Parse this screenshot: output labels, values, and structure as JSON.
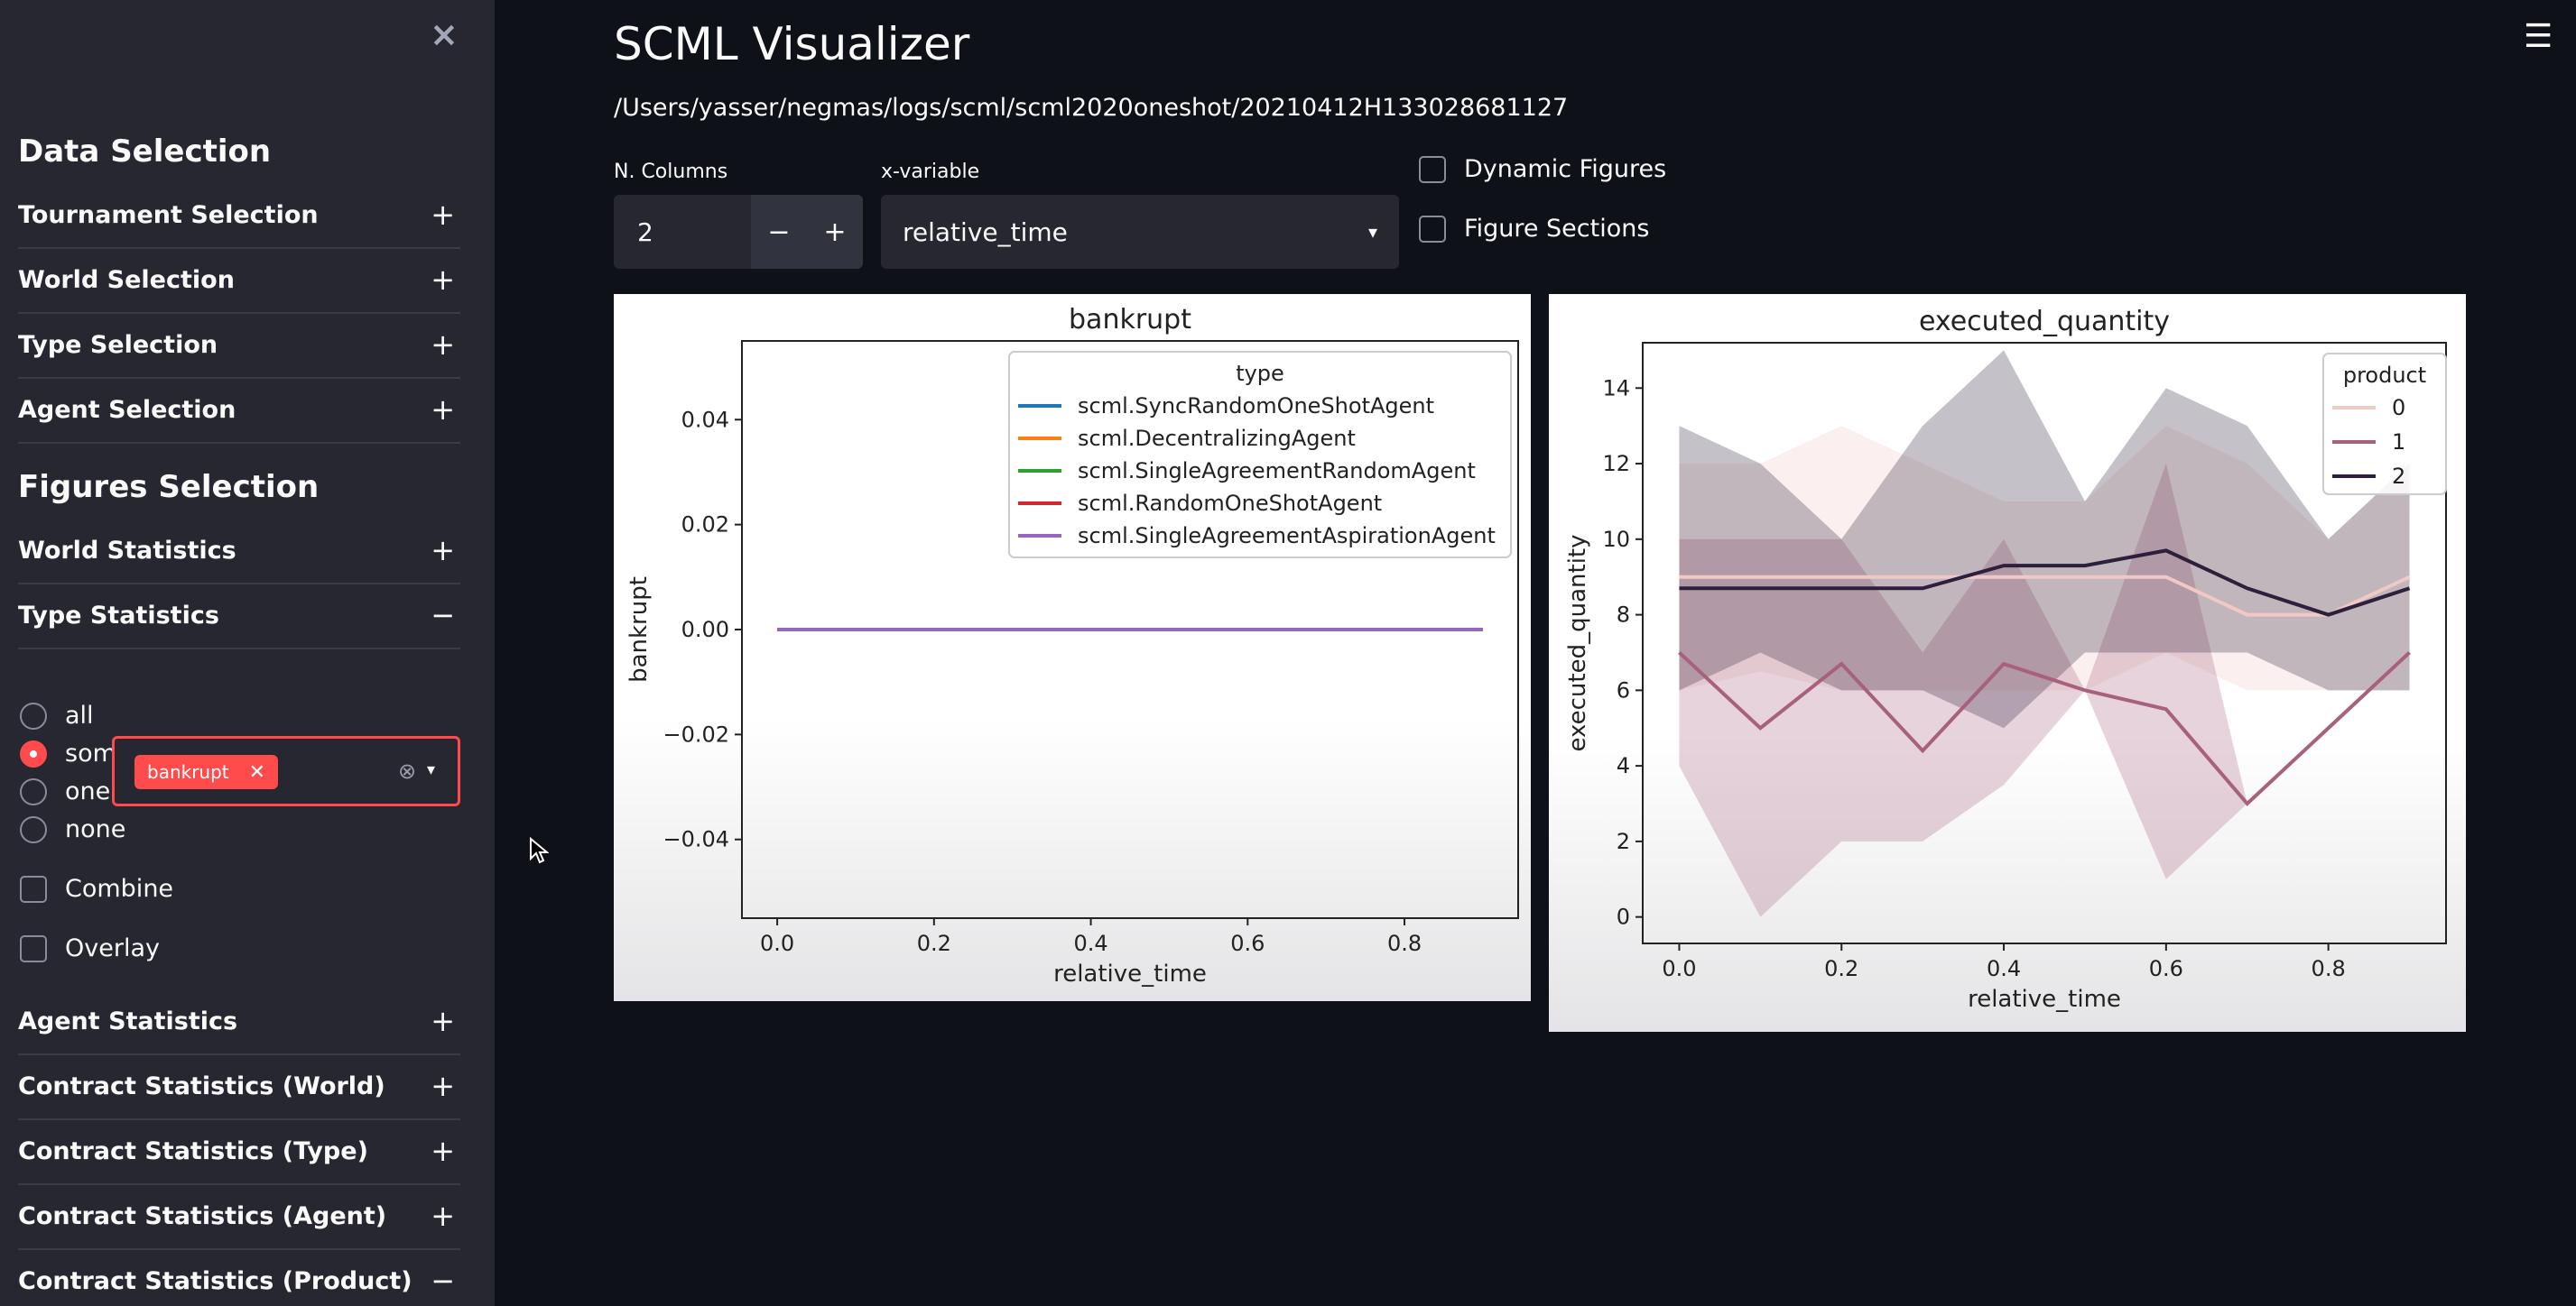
{
  "sidebar": {
    "close_icon": "×",
    "data_selection_heading": "Data Selection",
    "data_items": [
      {
        "label": "Tournament Selection",
        "sign": "+"
      },
      {
        "label": "World Selection",
        "sign": "+"
      },
      {
        "label": "Type Selection",
        "sign": "+"
      },
      {
        "label": "Agent Selection",
        "sign": "+"
      }
    ],
    "figures_selection_heading": "Figures Selection",
    "figure_items_top": [
      {
        "label": "World Statistics",
        "sign": "+"
      },
      {
        "label": "Type Statistics",
        "sign": "−"
      }
    ],
    "radio_options": [
      "all",
      "som",
      "one",
      "none"
    ],
    "radio_selected": "some",
    "multiselect": {
      "tag": "bankrupt",
      "tag_remove": "✕",
      "clear": "⊗",
      "arrow": "▾"
    },
    "checkboxes": [
      "Combine",
      "Overlay"
    ],
    "figure_items_bottom": [
      {
        "label": "Agent Statistics",
        "sign": "+"
      },
      {
        "label": "Contract Statistics (World)",
        "sign": "+"
      },
      {
        "label": "Contract Statistics (Type)",
        "sign": "+"
      },
      {
        "label": "Contract Statistics (Agent)",
        "sign": "+"
      },
      {
        "label": "Contract Statistics (Product)",
        "sign": "−"
      }
    ]
  },
  "main": {
    "title": "SCML Visualizer",
    "path": "/Users/yasser/negmas/logs/scml/scml2020oneshot/20210412H133028681127",
    "ncols_label": "N. Columns",
    "ncols_value": "2",
    "minus": "−",
    "plus": "+",
    "xvar_label": "x-variable",
    "xvar_value": "relative_time",
    "xvar_arrow": "▾",
    "dynamic_figures": "Dynamic Figures",
    "figure_sections": "Figure Sections",
    "menu_icon": "☰"
  },
  "chart_data": [
    {
      "type": "line",
      "title": "bankrupt",
      "xlabel": "relative_time",
      "ylabel": "bankrupt",
      "xlim": [
        -0.045,
        0.945
      ],
      "ylim": [
        -0.055,
        0.055
      ],
      "xticks": [
        "0.0",
        "0.2",
        "0.4",
        "0.6",
        "0.8"
      ],
      "yticks": [
        "0.04",
        "0.02",
        "0.00",
        "−0.02",
        "−0.04"
      ],
      "legend_title": "type",
      "legend_position": "top-right",
      "series": [
        {
          "name": "scml.SyncRandomOneShotAgent",
          "color": "#1f77b4",
          "x": [
            0.0,
            0.9
          ],
          "y": [
            0,
            0
          ]
        },
        {
          "name": "scml.DecentralizingAgent",
          "color": "#ff7f0e",
          "x": [
            0.0,
            0.9
          ],
          "y": [
            0,
            0
          ]
        },
        {
          "name": "scml.SingleAgreementRandomAgent",
          "color": "#2ca02c",
          "x": [
            0.0,
            0.9
          ],
          "y": [
            0,
            0
          ]
        },
        {
          "name": "scml.RandomOneShotAgent",
          "color": "#d62728",
          "x": [
            0.0,
            0.9
          ],
          "y": [
            0,
            0
          ]
        },
        {
          "name": "scml.SingleAgreementAspirationAgent",
          "color": "#9467bd",
          "x": [
            0.0,
            0.9
          ],
          "y": [
            0,
            0
          ]
        }
      ]
    },
    {
      "type": "line",
      "title": "executed_quantity",
      "xlabel": "relative_time",
      "ylabel": "executed_quantity",
      "xlim": [
        -0.045,
        0.945
      ],
      "ylim": [
        -0.7,
        15.2
      ],
      "xticks": [
        "0.0",
        "0.2",
        "0.4",
        "0.6",
        "0.8"
      ],
      "yticks": [
        "14",
        "12",
        "10",
        "8",
        "6",
        "4",
        "2",
        "0"
      ],
      "legend_title": "product",
      "legend_position": "top-right",
      "x": [
        0.0,
        0.1,
        0.2,
        0.3,
        0.4,
        0.5,
        0.6,
        0.7,
        0.8,
        0.9
      ],
      "series": [
        {
          "name": "0",
          "color": "#f0c9c6",
          "y": [
            9,
            9,
            9,
            9,
            9,
            9,
            9,
            8,
            8,
            9
          ],
          "lower": [
            6,
            6.5,
            6,
            6,
            6,
            6,
            7,
            6,
            6,
            6
          ],
          "upper": [
            12,
            12,
            13,
            12,
            11,
            11,
            13,
            12,
            10,
            12
          ]
        },
        {
          "name": "1",
          "color": "#a8607f",
          "y": [
            7,
            5,
            6.7,
            4.4,
            6.7,
            6,
            5.5,
            3,
            5,
            7
          ],
          "lower": [
            4,
            0,
            2,
            2,
            3.5,
            6,
            1,
            3,
            5,
            7
          ],
          "upper": [
            10,
            10,
            10,
            7,
            10,
            6,
            12,
            3,
            5,
            7
          ]
        },
        {
          "name": "2",
          "color": "#2e1f3c",
          "y": [
            8.7,
            8.7,
            8.7,
            8.7,
            9.3,
            9.3,
            9.7,
            8.7,
            8,
            8.7
          ],
          "lower": [
            6,
            7,
            6,
            6,
            5,
            7,
            7,
            7,
            6,
            6
          ],
          "upper": [
            13,
            12,
            10,
            13,
            15,
            11,
            14,
            13,
            10,
            12
          ]
        }
      ]
    }
  ]
}
